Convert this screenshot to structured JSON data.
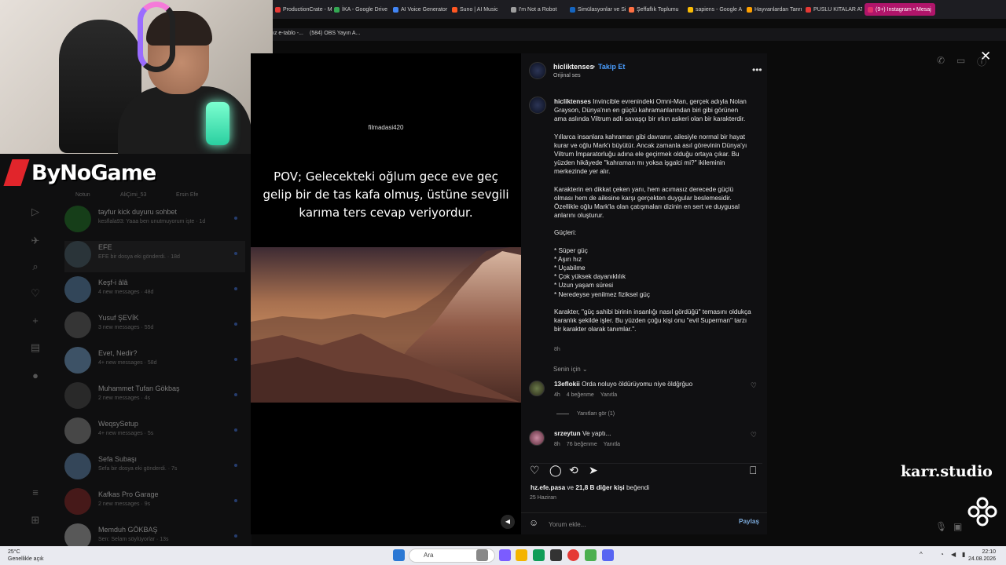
{
  "browser": {
    "tabs": [
      {
        "label": "ProductionCrate - M",
        "color": "#e53935"
      },
      {
        "label": "İKA - Google Drive",
        "color": "#34a853"
      },
      {
        "label": "AI Voice Generator",
        "color": "#4285f4"
      },
      {
        "label": "Suno | AI Music",
        "color": "#ff5722"
      },
      {
        "label": "I'm Not a Robot",
        "color": "#9e9e9e"
      },
      {
        "label": "Simülasyonlar ve Simü",
        "color": "#1565c0"
      },
      {
        "label": "Şeffaflık Toplumu",
        "color": "#ff7043"
      },
      {
        "label": "sapiens - Google A",
        "color": "#fbbc05"
      },
      {
        "label": "Hayvanlardan Tanrı",
        "color": "#ffa000"
      },
      {
        "label": "PUSLU KITALAR AT",
        "color": "#e53935"
      },
      {
        "label": "(9+) Instagram • Mesaj",
        "color": "#e1306c"
      }
    ],
    "bookmarks": [
      {
        "label": "ız e-tablo -...",
        "color": "#34a853"
      },
      {
        "label": "(584) OBS Yayın A...",
        "color": "#e53935"
      }
    ]
  },
  "inbox": {
    "stories": [
      "Notun",
      "AliÇimi_53",
      "Ersin Efe"
    ],
    "rows": [
      {
        "name": "tayfur kick duyuru sohbet",
        "sub": "kesflala93: Yaaa ben unutmuyorum işte · 1d",
        "avatar": "#1b5e20"
      },
      {
        "name": "EFE",
        "sub": "EFE bir dosya eki gönderdi. · 18d",
        "avatar": "#37474f"
      },
      {
        "name": "Keşf-i âlâ",
        "sub": "4 new messages · 48d",
        "avatar": "#4a6a8a"
      },
      {
        "name": "Yusuf ŞEVİK",
        "sub": "3 new messages · 55d",
        "avatar": "#4e4e4e"
      },
      {
        "name": "Evet, Nedir?",
        "sub": "4+ new messages · 58d",
        "avatar": "#5b7ea0"
      },
      {
        "name": "Muhammet Tufan Gökbaş",
        "sub": "2 new messages · 4s",
        "avatar": "#3a3a3a"
      },
      {
        "name": "WeqsySetup",
        "sub": "4+ new messages · 5s",
        "avatar": "#6d6d6d"
      },
      {
        "name": "Sefa Subaşı",
        "sub": "Sefa bir dosya eki gönderdi. · 7s",
        "avatar": "#4d6b8a"
      },
      {
        "name": "Kafkas Pro Garage",
        "sub": "2 new messages · 9s",
        "avatar": "#6b1f1f"
      },
      {
        "name": "Memduh GÖKBAŞ",
        "sub": "Sen: Selam söylüyorlar · 13s",
        "avatar": "#888888"
      }
    ]
  },
  "stream": {
    "logo": "ByNoGame",
    "watermark": "karr.studio"
  },
  "video": {
    "username": "filmadasi420",
    "caption": "POV; Gelecekteki oğlum gece eve geç gelip bir de tas kafa olmuş, üstüne sevgili karıma ters cevap veriyordur."
  },
  "post": {
    "username": "hicliktenses",
    "follow_label": "Takip Et",
    "audio": "Orijinal ses",
    "caption_paragraphs": [
      "Invincible evrenindeki Omni-Man, gerçek adıyla Nolan Grayson, Dünya'nın en güçlü kahramanlarından biri gibi görünen ama aslında Viltrum adlı savaşçı bir ırkın askeri olan bir karakterdir.",
      "Yıllarca insanlara kahraman gibi davranır, ailesiyle normal bir hayat kurar ve oğlu Mark'ı büyütür. Ancak zamanla asıl görevinin Dünya'yı Viltrum İmparatorluğu adına ele geçirmek olduğu ortaya çıkar. Bu yüzden hikâyede \"kahraman mı yoksa işgalci mi?\" ikileminin merkezinde yer alır.",
      "Karakterin en dikkat çeken yanı, hem acımasız derecede güçlü olması hem de ailesine karşı gerçekten duygular beslemesidir. Özellikle oğlu Mark'la olan çatışmaları dizinin en sert ve duygusal anlarını oluşturur.",
      "Güçleri:",
      "* Süper güç\n* Aşırı hız\n* Uçabilme\n* Çok yüksek dayanıklılık\n* Uzun yaşam süresi\n* Neredeyse yenilmez fiziksel güç",
      "Karakter, \"güç sahibi birinin insanlığı nasıl gördüğü\" temasını oldukça karanlık şekilde işler. Bu yüzden çoğu kişi onu \"evil Superman\" tarzı bir karakter olarak tanımlar.\"."
    ],
    "caption_time": "8h",
    "for_you": "Senin için",
    "comments": [
      {
        "user": "13eflokii",
        "text": "Orda noluyo öldürüyomu niye öldğrğuo",
        "time": "4h",
        "likes": "4 beğenme",
        "reply": "Yanıtla"
      },
      {
        "user": "srzeytun",
        "text": "Ve yaptı...",
        "time": "8h",
        "likes": "76 beğenme",
        "reply": "Yanıtla"
      }
    ],
    "see_replies": "Yanıtları gör (1)",
    "liked_by_user": "hz.efe.pasa",
    "liked_by_rest": " ve ",
    "liked_by_count": "21,8 B diğer kişi",
    "liked_by_tail": " beğendi",
    "date": "25 Haziran",
    "comment_placeholder": "Yorum ekle...",
    "share_label": "Paylaş"
  },
  "taskbar": {
    "weather_temp": "25°C",
    "weather_desc": "Genellikle açık",
    "search_placeholder": "Ara",
    "time": "22:10",
    "date": "24.08.2026"
  },
  "icons": {
    "close": "close-icon",
    "more": "more-icon",
    "heart": "heart-icon",
    "comment": "comment-icon",
    "repost": "repost-icon",
    "share": "share-icon",
    "bookmark": "bookmark-icon",
    "emoji": "emoji-icon",
    "mute": "speaker-icon"
  },
  "colors": {
    "accent": "#4a9eff",
    "brand": "#e1252b",
    "active_tab": "#b0156a"
  }
}
